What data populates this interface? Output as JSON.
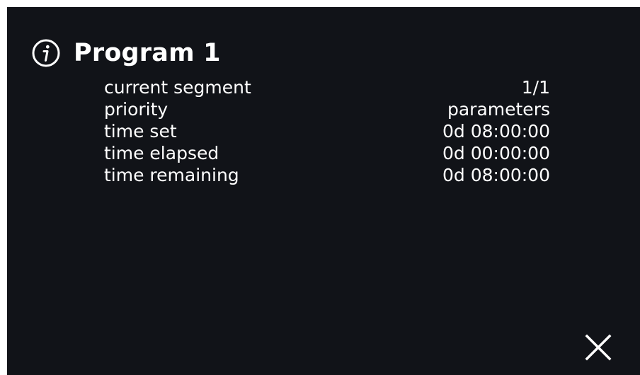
{
  "program": {
    "title": "Program 1",
    "icon": "info-icon"
  },
  "details": [
    {
      "label": "current segment",
      "value": "1/1"
    },
    {
      "label": "priority",
      "value": "parameters"
    },
    {
      "label": "time set",
      "value": "0d 08:00:00"
    },
    {
      "label": "time elapsed",
      "value": "0d 00:00:00"
    },
    {
      "label": "time remaining",
      "value": "0d 08:00:00"
    }
  ],
  "actions": {
    "close_icon": "close-icon"
  },
  "colors": {
    "background": "#111318",
    "text": "#ffffff"
  }
}
